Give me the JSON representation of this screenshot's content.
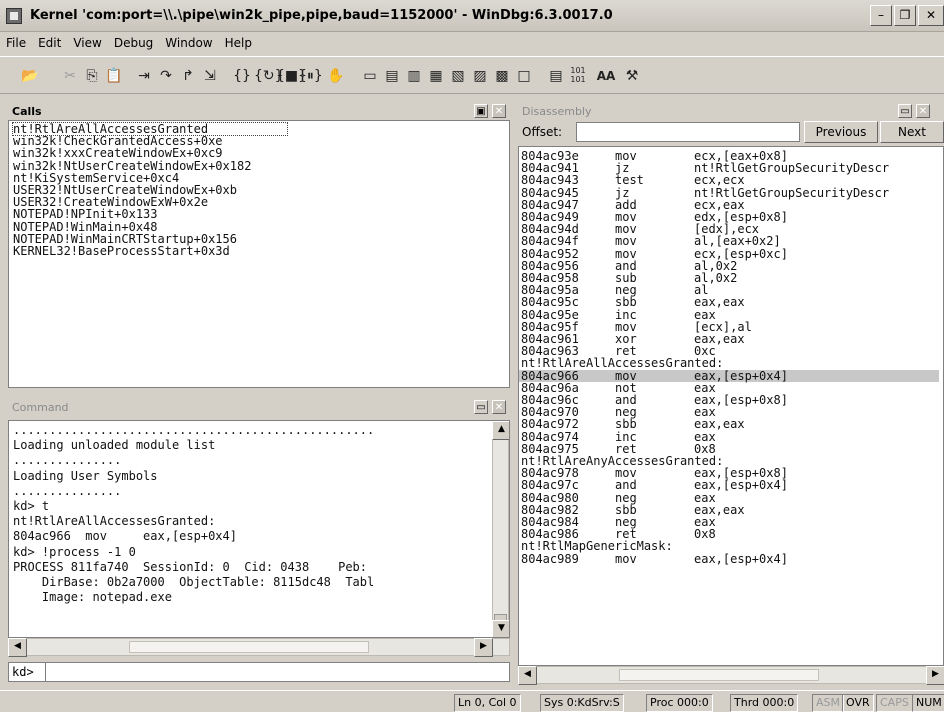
{
  "window": {
    "title": "Kernel 'com:port=\\\\.\\pipe\\win2k_pipe,pipe,baud=1152000' - WinDbg:6.3.0017.0",
    "min_glyph": "–",
    "max_glyph": "❐",
    "close_glyph": "✕"
  },
  "menu": [
    {
      "label": "File"
    },
    {
      "label": "Edit"
    },
    {
      "label": "View"
    },
    {
      "label": "Debug"
    },
    {
      "label": "Window"
    },
    {
      "label": "Help"
    }
  ],
  "toolbar": {
    "font_label": "AA",
    "binary_label": "101\n101"
  },
  "calls": {
    "title": "Calls",
    "frames": [
      "nt!RtlAreAllAccessesGranted",
      "win32k!CheckGrantedAccess+0xe",
      "win32k!xxxCreateWindowEx+0xc9",
      "win32k!NtUserCreateWindowEx+0x182",
      "nt!KiSystemService+0xc4",
      "USER32!NtUserCreateWindowEx+0xb",
      "USER32!CreateWindowExW+0x2e",
      "NOTEPAD!NPInit+0x133",
      "NOTEPAD!WinMain+0x48",
      "NOTEPAD!WinMainCRTStartup+0x156",
      "KERNEL32!BaseProcessStart+0x3d"
    ]
  },
  "command": {
    "title": "Command",
    "output": [
      "..................................................",
      "Loading unloaded module list",
      "...............",
      "Loading User Symbols",
      "...............",
      "kd> t",
      "nt!RtlAreAllAccessesGranted:",
      "804ac966  mov     eax,[esp+0x4]",
      "kd> !process -1 0",
      "PROCESS 811fa740  SessionId: 0  Cid: 0438    Peb:",
      "    DirBase: 0b2a7000  ObjectTable: 8115dc48  Tabl",
      "    Image: notepad.exe"
    ],
    "prompt": "kd>",
    "input_value": ""
  },
  "disassembly": {
    "title": "Disassembly",
    "offset_label": "Offset:",
    "offset_value": "",
    "previous_label": "Previous",
    "next_label": "Next",
    "rows": [
      {
        "addr": "804ac93e",
        "op": "mov",
        "args": "ecx,[eax+0x8]"
      },
      {
        "addr": "804ac941",
        "op": "jz",
        "args": "nt!RtlGetGroupSecurityDescr"
      },
      {
        "addr": "804ac943",
        "op": "test",
        "args": "ecx,ecx"
      },
      {
        "addr": "804ac945",
        "op": "jz",
        "args": "nt!RtlGetGroupSecurityDescr"
      },
      {
        "addr": "804ac947",
        "op": "add",
        "args": "ecx,eax"
      },
      {
        "addr": "804ac949",
        "op": "mov",
        "args": "edx,[esp+0x8]"
      },
      {
        "addr": "804ac94d",
        "op": "mov",
        "args": "[edx],ecx"
      },
      {
        "addr": "804ac94f",
        "op": "mov",
        "args": "al,[eax+0x2]"
      },
      {
        "addr": "804ac952",
        "op": "mov",
        "args": "ecx,[esp+0xc]"
      },
      {
        "addr": "804ac956",
        "op": "and",
        "args": "al,0x2"
      },
      {
        "addr": "804ac958",
        "op": "sub",
        "args": "al,0x2"
      },
      {
        "addr": "804ac95a",
        "op": "neg",
        "args": "al"
      },
      {
        "addr": "804ac95c",
        "op": "sbb",
        "args": "eax,eax"
      },
      {
        "addr": "804ac95e",
        "op": "inc",
        "args": "eax"
      },
      {
        "addr": "804ac95f",
        "op": "mov",
        "args": "[ecx],al"
      },
      {
        "addr": "804ac961",
        "op": "xor",
        "args": "eax,eax"
      },
      {
        "addr": "804ac963",
        "op": "ret",
        "args": "0xc"
      },
      {
        "label": "nt!RtlAreAllAccessesGranted:"
      },
      {
        "addr": "804ac966",
        "op": "mov",
        "args": "eax,[esp+0x4]",
        "highlight": true
      },
      {
        "addr": "804ac96a",
        "op": "not",
        "args": "eax"
      },
      {
        "addr": "804ac96c",
        "op": "and",
        "args": "eax,[esp+0x8]"
      },
      {
        "addr": "804ac970",
        "op": "neg",
        "args": "eax"
      },
      {
        "addr": "804ac972",
        "op": "sbb",
        "args": "eax,eax"
      },
      {
        "addr": "804ac974",
        "op": "inc",
        "args": "eax"
      },
      {
        "addr": "804ac975",
        "op": "ret",
        "args": "0x8"
      },
      {
        "label": "nt!RtlAreAnyAccessesGranted:"
      },
      {
        "addr": "804ac978",
        "op": "mov",
        "args": "eax,[esp+0x8]"
      },
      {
        "addr": "804ac97c",
        "op": "and",
        "args": "eax,[esp+0x4]"
      },
      {
        "addr": "804ac980",
        "op": "neg",
        "args": "eax"
      },
      {
        "addr": "804ac982",
        "op": "sbb",
        "args": "eax,eax"
      },
      {
        "addr": "804ac984",
        "op": "neg",
        "args": "eax"
      },
      {
        "addr": "804ac986",
        "op": "ret",
        "args": "0x8"
      },
      {
        "label": "nt!RtlMapGenericMask:"
      },
      {
        "addr": "804ac989",
        "op": "mov",
        "args": "eax,[esp+0x4]"
      }
    ]
  },
  "status": {
    "ln_col": "Ln 0, Col 0",
    "sys": "Sys 0:KdSrv:S",
    "proc": "Proc 000:0",
    "thrd": "Thrd 000:0",
    "asm": "ASM",
    "ovr": "OVR",
    "caps": "CAPS",
    "num": "NUM"
  }
}
